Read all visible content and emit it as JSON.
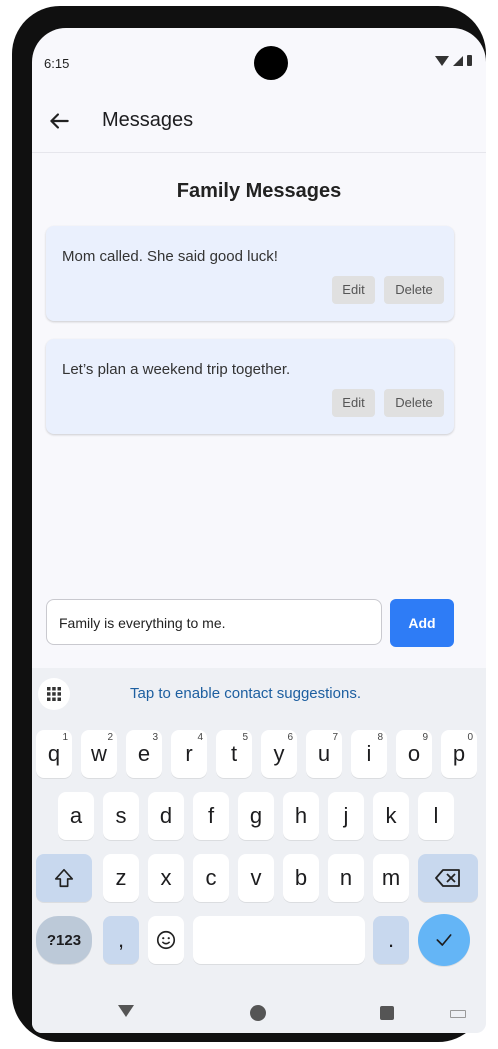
{
  "status_bar": {
    "time": "6:15"
  },
  "app_bar": {
    "title": "Messages",
    "back_icon": "arrow-left-icon"
  },
  "page_title": "Family Messages",
  "messages": [
    {
      "text": "Mom called. She said good luck!",
      "edit_label": "Edit",
      "delete_label": "Delete"
    },
    {
      "text": "Let’s plan a weekend trip together.",
      "edit_label": "Edit",
      "delete_label": "Delete"
    }
  ],
  "compose": {
    "value": "Family is everything to me.",
    "add_label": "Add"
  },
  "keyboard": {
    "suggestion": "Tap to enable contact suggestions.",
    "row1": [
      "q",
      "w",
      "e",
      "r",
      "t",
      "y",
      "u",
      "i",
      "o",
      "p"
    ],
    "row1_hints": [
      "1",
      "2",
      "3",
      "4",
      "5",
      "6",
      "7",
      "8",
      "9",
      "0"
    ],
    "row2": [
      "a",
      "s",
      "d",
      "f",
      "g",
      "h",
      "j",
      "k",
      "l"
    ],
    "row3": [
      "z",
      "x",
      "c",
      "v",
      "b",
      "n",
      "m"
    ],
    "symbols_label": "?123",
    "comma": ",",
    "period": "."
  },
  "colors": {
    "accent": "#2e7cf6",
    "card_bg": "#eaf0fd",
    "enter_key": "#64b5f6"
  }
}
